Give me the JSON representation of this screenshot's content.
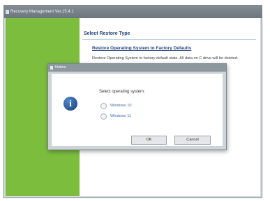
{
  "window": {
    "title": "Recovery Management Ver.15.4.1"
  },
  "content": {
    "section_title": "Select Restore Type",
    "option_title": "Restore Operating System to Factory Defaults",
    "option_desc": "Restore Operating System to factory default state. All data on C drive will be deleted."
  },
  "dialog": {
    "title": "Notice",
    "prompt": "Select operating system:",
    "options": [
      {
        "label": "Windows 10",
        "selected": false
      },
      {
        "label": "Windows 11",
        "selected": false
      }
    ],
    "ok_label": "OK",
    "cancel_label": "Cancel",
    "icon": "info-icon"
  },
  "colors": {
    "sidebar": "#7cbd3e",
    "heading": "#1f3f7a",
    "window_frame": "#d4d9dc"
  }
}
